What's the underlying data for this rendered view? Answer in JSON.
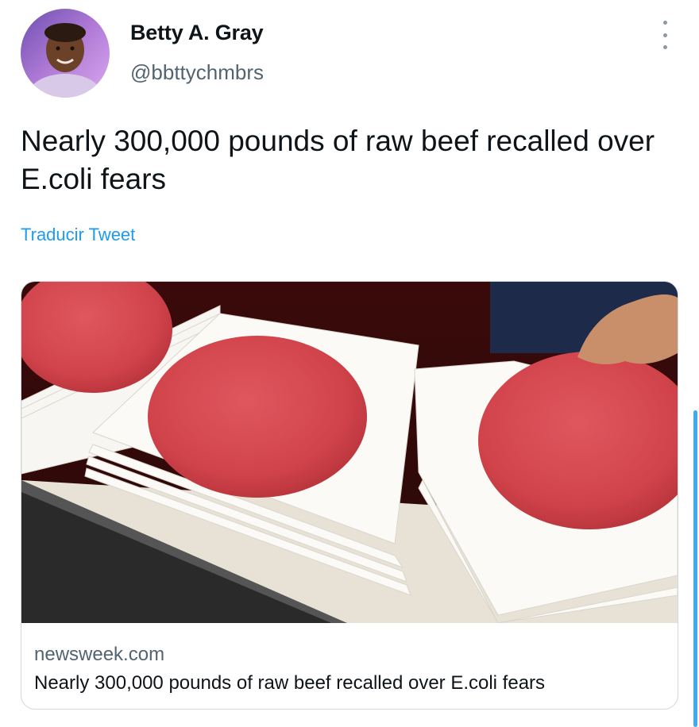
{
  "author": {
    "display_name": "Betty A. Gray",
    "handle": "@bbttychmbrs",
    "avatar_icon": "profile-photo"
  },
  "tweet": {
    "text": "Nearly 300,000 pounds of raw beef recalled over E.coli fears",
    "translate_label": "Traducir Tweet",
    "more_icon": "more-vertical-icon"
  },
  "link_card": {
    "domain": "newsweek.com",
    "title": "Nearly 300,000 pounds of raw beef recalled over E.coli fears",
    "image_icon": "raw-beef-patties-photo"
  },
  "colors": {
    "accent": "#1d9bf0",
    "secondary_text": "#536471",
    "border": "#cfd9de"
  }
}
